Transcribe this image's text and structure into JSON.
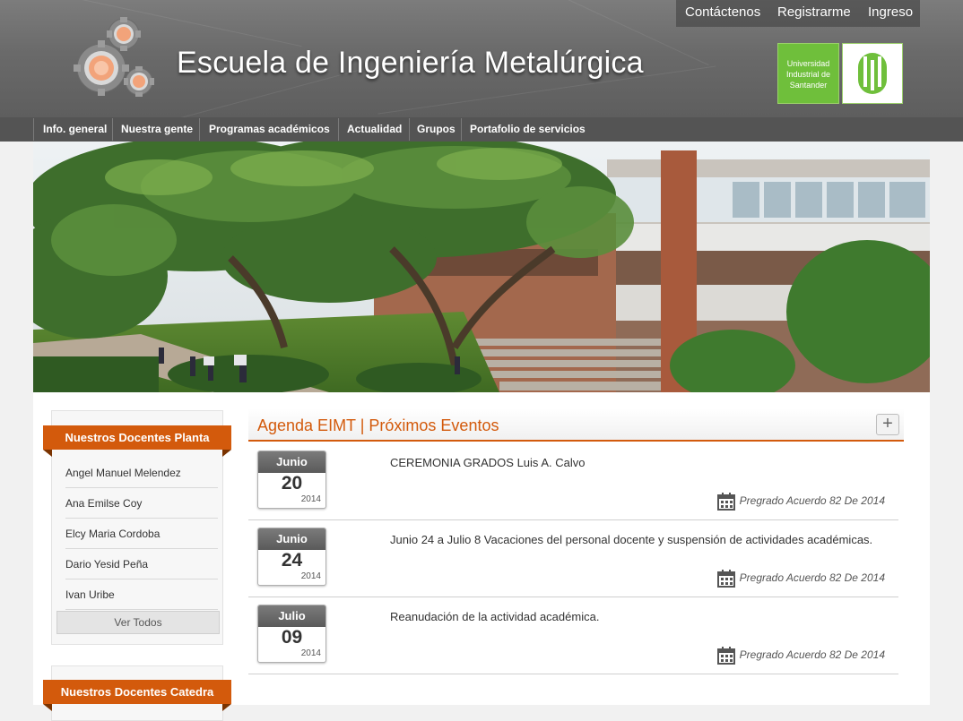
{
  "header": {
    "title": "Escuela de Ingeniería Metalúrgica",
    "top_links": [
      "Contáctenos",
      "Registrarme",
      "Ingreso"
    ],
    "uis_lines": [
      "Universidad",
      "Industrial de",
      "Santander"
    ]
  },
  "nav": {
    "items": [
      "Info. general",
      "Nuestra gente",
      "Programas académicos",
      "Actualidad",
      "Grupos",
      "Portafolio de servicios"
    ]
  },
  "sidebar": {
    "planta_title": "Nuestros Docentes Planta",
    "planta_items": [
      "Angel Manuel Melendez",
      "Ana Emilse Coy",
      "Elcy Maria Cordoba",
      "Dario Yesid Peña",
      "Ivan Uribe"
    ],
    "ver_todos": "Ver Todos",
    "catedra_title": "Nuestros Docentes Catedra"
  },
  "agenda": {
    "title": "Agenda EIMT | Próximos Eventos",
    "plus": "+",
    "events": [
      {
        "month": "Junio",
        "day": "20",
        "year": "2014",
        "text": "CEREMONIA GRADOS Luis A. Calvo",
        "category": "Pregrado Acuerdo 82 De 2014"
      },
      {
        "month": "Junio",
        "day": "24",
        "year": "2014",
        "text": "Junio 24 a Julio 8 Vacaciones del personal docente y suspensión de actividades académicas.",
        "category": "Pregrado Acuerdo 82 De 2014"
      },
      {
        "month": "Julio",
        "day": "09",
        "year": "2014",
        "text": "Reanudación de la actividad académica.",
        "category": "Pregrado Acuerdo 82 De 2014"
      }
    ]
  },
  "colors": {
    "accent": "#d35a0c",
    "uis_green": "#6fbf3b",
    "nav_bg": "#545454"
  }
}
